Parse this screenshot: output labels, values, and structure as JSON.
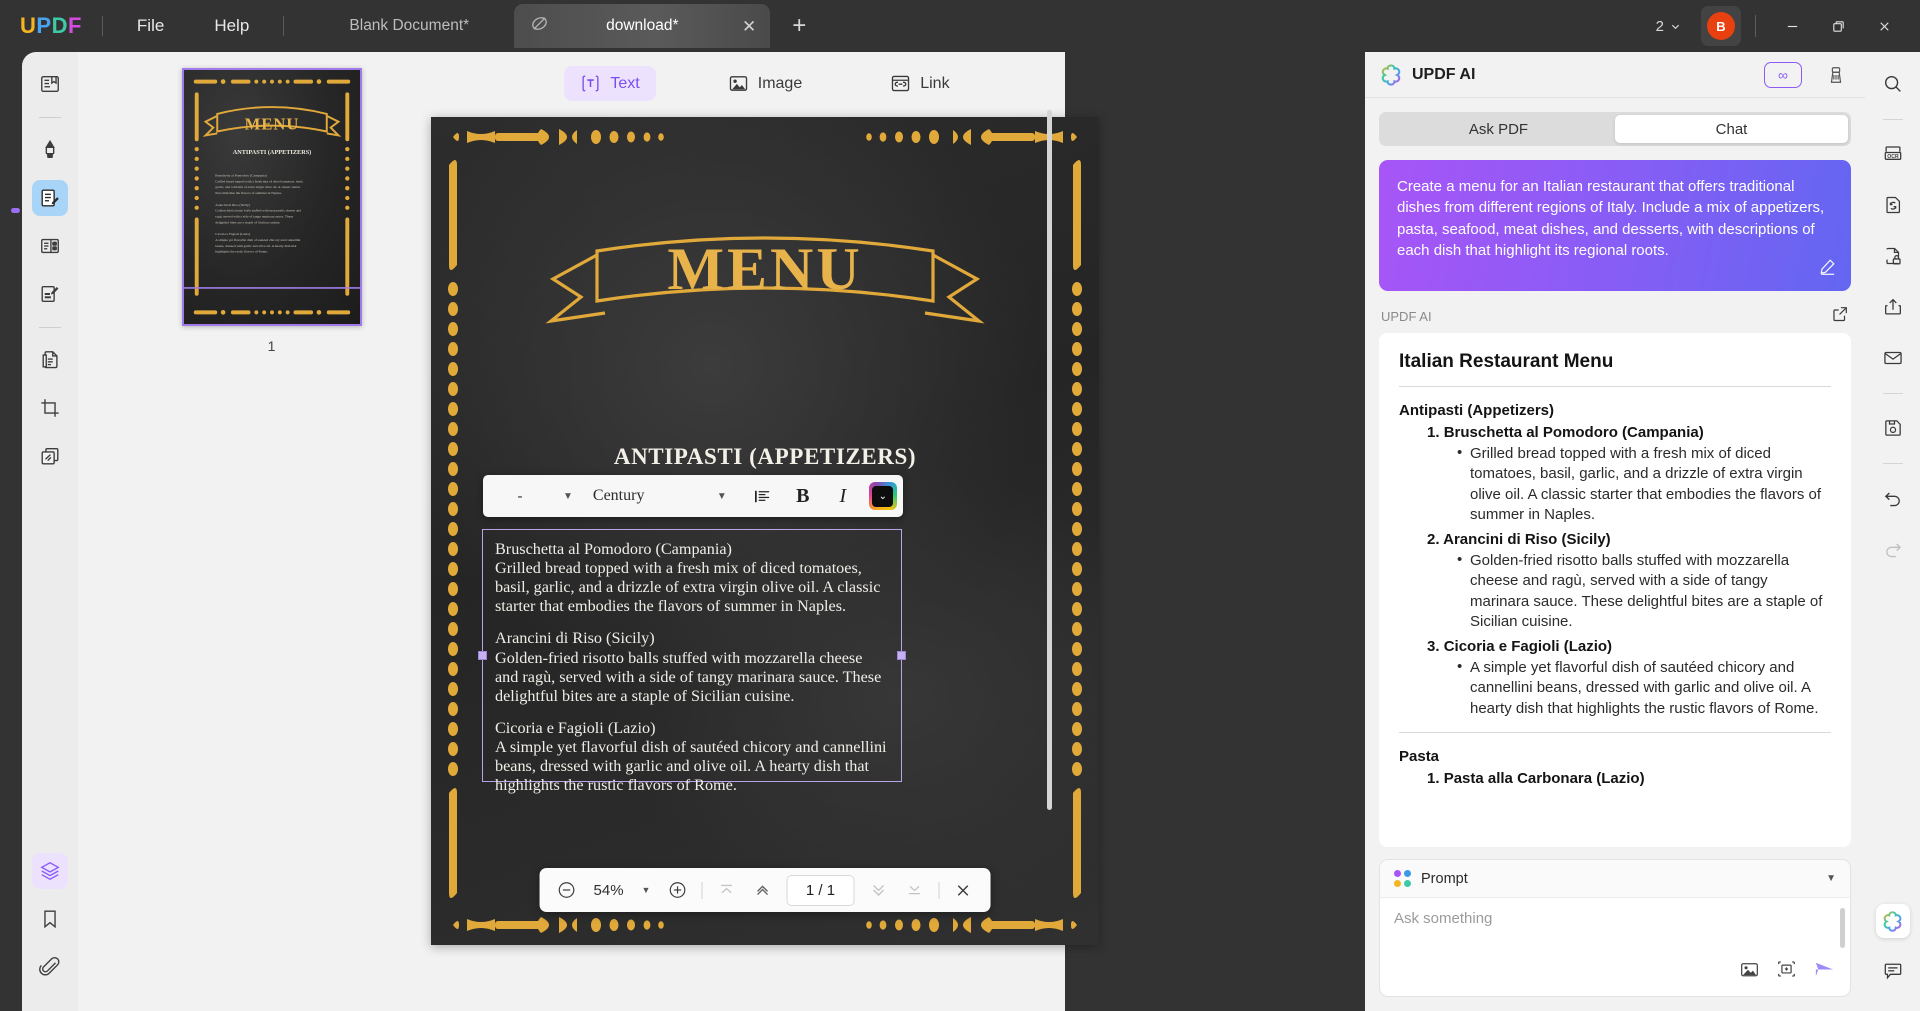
{
  "titlebar": {
    "logo": "UPDF",
    "menus": [
      "File",
      "Help"
    ],
    "tabs": [
      {
        "label": "Blank Document*",
        "active": false
      },
      {
        "label": "download*",
        "active": true
      }
    ],
    "new_tab": "+",
    "page_count": "2",
    "avatar_initial": "B",
    "window_buttons": {
      "minimize": "minimize-icon",
      "maximize": "maximize-icon",
      "close": "close-icon"
    }
  },
  "left_rail": {
    "items": [
      {
        "name": "reader-icon",
        "label": "Reader"
      },
      {
        "name": "annotate-icon",
        "label": "Comment"
      },
      {
        "name": "edit-pdf-icon",
        "label": "Edit PDF"
      },
      {
        "name": "organize-pages-icon",
        "label": "Organize Pages"
      },
      {
        "name": "fill-sign-icon",
        "label": "Fill & Sign"
      },
      {
        "name": "convert-pdf-icon",
        "label": "Convert PDF"
      },
      {
        "name": "crop-icon",
        "label": "Crop"
      },
      {
        "name": "batch-icon",
        "label": "Batch"
      }
    ],
    "bottom_items": [
      {
        "name": "layers-icon",
        "label": "Layers"
      },
      {
        "name": "bookmark-icon",
        "label": "Bookmark"
      },
      {
        "name": "attachment-icon",
        "label": "Attachment"
      }
    ]
  },
  "thumbnails": {
    "pages": [
      {
        "number": "1"
      }
    ]
  },
  "edit_toolbar": {
    "items": [
      {
        "label": "Text",
        "icon": "text-tool-icon",
        "active": true
      },
      {
        "label": "Image",
        "icon": "image-tool-icon",
        "active": false
      },
      {
        "label": "Link",
        "icon": "link-tool-icon",
        "active": false
      }
    ]
  },
  "format_bar": {
    "font_size": "-",
    "font_family": "Century",
    "align_icon": "align-left-icon",
    "bold": "B",
    "italic": "I",
    "ai_button": "ai-color-icon"
  },
  "document": {
    "banner_title": "MENU",
    "section_title": "ANTIPASTI (APPETIZERS)",
    "dishes": [
      {
        "heading": "Bruschetta al Pomodoro (Campania)",
        "body": "Grilled bread topped with a fresh mix of diced tomatoes, basil, garlic, and a drizzle of extra virgin olive oil. A classic starter that embodies the flavors of summer in Naples."
      },
      {
        "heading": "Arancini di Riso (Sicily)",
        "body": "Golden-fried risotto balls stuffed with mozzarella cheese and ragù, served with a side of tangy marinara sauce. These delightful bites are a staple of Sicilian cuisine."
      },
      {
        "heading": "Cicoria e Fagioli (Lazio)",
        "body": "A simple yet flavorful dish of sautéed chicory and cannellini beans, dressed with garlic and olive oil. A hearty dish that highlights the rustic flavors of Rome."
      }
    ]
  },
  "nav_bar": {
    "zoom_out": "zoom-out-icon",
    "zoom_level": "54%",
    "zoom_in": "zoom-in-icon",
    "first_page": "first-page-icon",
    "prev_page": "prev-page-icon",
    "page_indicator": "1 / 1",
    "next_page": "next-page-icon",
    "last_page": "last-page-icon",
    "close": "close-icon"
  },
  "ai_panel": {
    "title": "UPDF AI",
    "logo_icon": "updf-ai-icon",
    "infinity_badge": "∞",
    "eraser_icon": "eraser-icon",
    "tabs": [
      {
        "label": "Ask PDF",
        "active": false
      },
      {
        "label": "Chat",
        "active": true
      }
    ],
    "user_prompt": "Create a menu for an Italian restaurant that offers traditional dishes from different regions of Italy. Include a mix of appetizers, pasta, seafood, meat dishes, and desserts, with descriptions of each dish that highlight its regional roots.",
    "edit_prompt_icon": "edit-pencil-icon",
    "response_author": "UPDF AI",
    "open_external_icon": "open-external-icon",
    "response": {
      "title": "Italian Restaurant Menu",
      "sections": [
        {
          "heading": "Antipasti (Appetizers)",
          "items": [
            {
              "number": "1.",
              "name": "Bruschetta al Pomodoro (Campania)",
              "desc": "Grilled bread topped with a fresh mix of diced tomatoes, basil, garlic, and a drizzle of extra virgin olive oil. A classic starter that embodies the flavors of summer in Naples."
            },
            {
              "number": "2.",
              "name": "Arancini di Riso (Sicily)",
              "desc": "Golden-fried risotto balls stuffed with mozzarella cheese and ragù, served with a side of tangy marinara sauce. These delightful bites are a staple of Sicilian cuisine."
            },
            {
              "number": "3.",
              "name": "Cicoria e Fagioli (Lazio)",
              "desc": "A simple yet flavorful dish of sautéed chicory and cannellini beans, dressed with garlic and olive oil. A hearty dish that highlights the rustic flavors of Rome."
            }
          ]
        },
        {
          "heading": "Pasta",
          "items": [
            {
              "number": "1.",
              "name": "Pasta alla Carbonara (Lazio)",
              "desc": ""
            }
          ]
        }
      ]
    },
    "input": {
      "mode_label": "Prompt",
      "mode_icon": "prompt-dots-icon",
      "placeholder": "Ask something",
      "image_icon": "insert-image-icon",
      "screenshot_icon": "screenshot-icon",
      "send_icon": "send-icon"
    }
  },
  "right_rail": {
    "items": [
      {
        "name": "search-icon"
      },
      {
        "name": "ocr-icon"
      },
      {
        "name": "convert-icon"
      },
      {
        "name": "protect-icon"
      },
      {
        "name": "share-icon"
      },
      {
        "name": "email-icon"
      },
      {
        "name": "save-icon"
      },
      {
        "name": "undo-icon"
      },
      {
        "name": "redo-icon"
      }
    ],
    "bottom_items": [
      {
        "name": "updf-ai-icon"
      },
      {
        "name": "comment-icon"
      }
    ]
  },
  "colors": {
    "accent_purple": "#8b5cf6",
    "titlebar_bg": "#333333",
    "panel_bg": "#f2f2f2",
    "avatar_bg": "#e8400f",
    "gold": "#e8b34a",
    "page_bg": "#2b2b2b"
  }
}
